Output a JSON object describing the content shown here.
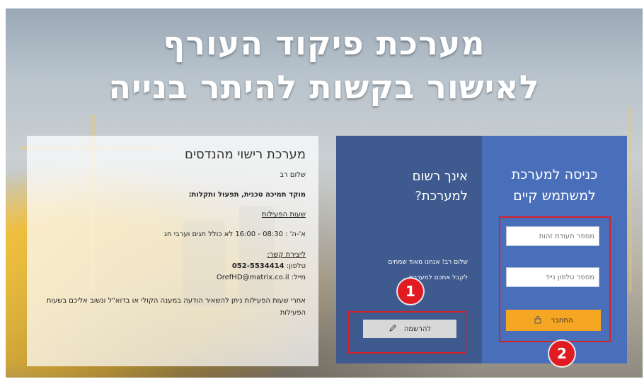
{
  "title": {
    "line1": "מערכת פיקוד העורף",
    "line2": "לאישור בקשות להיתר בנייה"
  },
  "info": {
    "heading": "מערכת רישוי מהנדסים",
    "greeting": "שלום רב",
    "support": "מוקד תמיכה טכנית, תפעול ותקלות:",
    "hours_title": "שעות הפעילות",
    "hours": "א'-ה' : 08:30 - 16:00 לא כולל חגים וערבי חג",
    "contact_title": "ליצירת קשר:",
    "phone_label": "טלפון:",
    "phone": "052-5534414",
    "email_label": "מייל:",
    "email": "OrefHD@matrix.co.il",
    "after_hours": "אחרי שעות הפעילות ניתן להשאיר הודעה במענה הקולי או בדוא\"ל ונשוב אליכם בשעות הפעילות"
  },
  "register": {
    "heading_line1": "אינך רשום",
    "heading_line2": "למערכת?",
    "message_line1": "שלום רב! אנחנו מאוד שמחים",
    "message_line2": "לקבל אתכם למערכת...",
    "button_label": "להרשמה"
  },
  "login": {
    "heading_line1": "כניסה למערכת",
    "heading_line2": "למשתמש קיים",
    "id_placeholder": "מספר תעודת זהות",
    "phone_placeholder": "מספר טלפון נייד",
    "connect_label": "התחבר"
  },
  "markers": {
    "m1": "1",
    "m2": "2"
  },
  "colors": {
    "register_panel": "#3f5a8f",
    "login_panel": "#4a6fba",
    "connect_button": "#f5a623",
    "highlight": "#d8202a"
  }
}
